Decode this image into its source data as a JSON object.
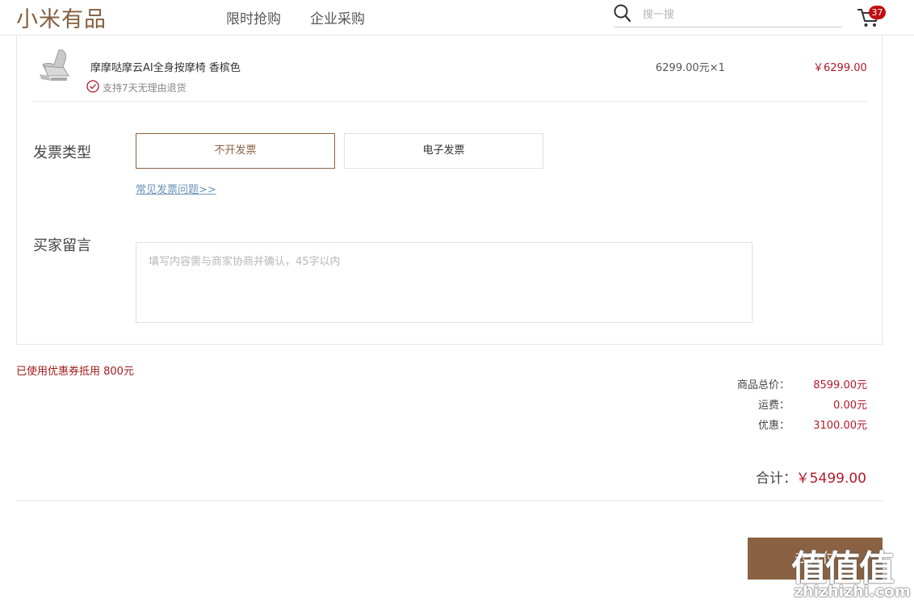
{
  "header": {
    "logo": "小米有品",
    "nav": [
      {
        "label": "限时抢购"
      },
      {
        "label": "企业采购"
      }
    ],
    "search": {
      "placeholder": "搜一搜",
      "value": ""
    },
    "cart_count": "37"
  },
  "product": {
    "name": "摩摩哒摩云AI全身按摩椅 香槟色",
    "return_policy": "支持7天无理由退货",
    "unit_price": "6299.00元×1",
    "total": "￥6299.00"
  },
  "invoice": {
    "label": "发票类型",
    "options": [
      {
        "label": "不开发票",
        "selected": true
      },
      {
        "label": "电子发票",
        "selected": false
      }
    ],
    "faq_link": "常见发票问题>>"
  },
  "message": {
    "label": "买家留言",
    "placeholder": "填写内容需与商家协商并确认，45字以内",
    "value": ""
  },
  "summary": {
    "coupon_note": "已使用优惠券抵用 800元",
    "rows": [
      {
        "label": "商品总价：",
        "value": "8599.00元"
      },
      {
        "label": "运费：",
        "value": "0.00元"
      },
      {
        "label": "优惠：",
        "value": "3100.00元"
      }
    ],
    "total_label": "合计：",
    "total_value": "￥5499.00"
  },
  "submit_label": "去支付",
  "watermark": {
    "text": "值值值",
    "url": "zhizhizhi.com"
  },
  "colors": {
    "brand": "#8a6243",
    "price_red": "#b4192a",
    "badge_red": "#c00f12",
    "link_blue": "#6a93b8"
  }
}
